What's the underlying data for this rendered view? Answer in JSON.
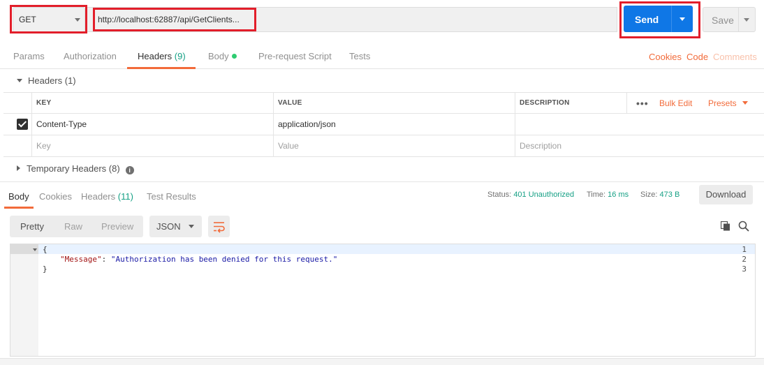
{
  "request": {
    "method": "GET",
    "url": "http://localhost:62887/api/GetClients...",
    "send_label": "Send",
    "save_label": "Save"
  },
  "request_tabs": [
    {
      "label": "Params"
    },
    {
      "label": "Authorization"
    },
    {
      "label": "Headers",
      "count": "(9)"
    },
    {
      "label": "Body"
    },
    {
      "label": "Pre-request Script"
    },
    {
      "label": "Tests"
    }
  ],
  "right_links": {
    "cookies": "Cookies",
    "code": "Code",
    "comments": "Comments"
  },
  "headers_section": {
    "title": "Headers (1)",
    "columns": [
      "KEY",
      "VALUE",
      "DESCRIPTION"
    ],
    "rows": [
      {
        "key": "Content-Type",
        "value": "application/json",
        "description": "",
        "checked": true
      }
    ],
    "placeholder": {
      "key": "Key",
      "value": "Value",
      "description": "Description"
    },
    "bulk_edit": "Bulk Edit",
    "presets": "Presets"
  },
  "temporary_headers": {
    "title": "Temporary Headers (8)"
  },
  "response_tabs": [
    {
      "label": "Body"
    },
    {
      "label": "Cookies"
    },
    {
      "label": "Headers",
      "count": "(11)"
    },
    {
      "label": "Test Results"
    }
  ],
  "response_status": {
    "status_label": "Status:",
    "status_value": "401 Unauthorized",
    "time_label": "Time:",
    "time_value": "16 ms",
    "size_label": "Size:",
    "size_value": "473 B",
    "download_label": "Download"
  },
  "view_modes": {
    "pretty": "Pretty",
    "raw": "Raw",
    "preview": "Preview",
    "format": "JSON"
  },
  "response_body": {
    "line_numbers": [
      "1",
      "2",
      "3"
    ],
    "open_brace": "{",
    "key": "\"Message\"",
    "colon": ": ",
    "value": "\"Authorization has been denied for this request.\"",
    "close_brace": "}"
  },
  "colors": {
    "send": "#0f77e6",
    "accent": "#f26b3a",
    "status_ok_text": "#16a085",
    "highlight": "#e21e2a"
  }
}
